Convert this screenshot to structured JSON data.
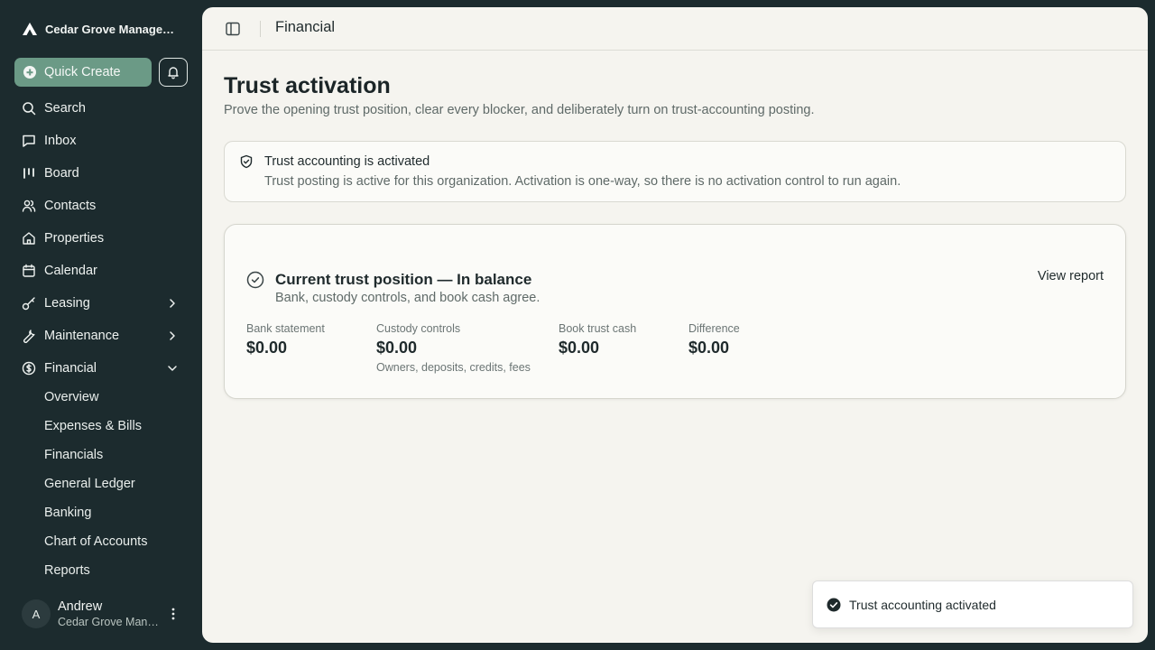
{
  "sidebar": {
    "org_name": "Cedar Grove Manageme...",
    "quick_create_label": "Quick Create",
    "nav": {
      "search": "Search",
      "inbox": "Inbox",
      "board": "Board",
      "contacts": "Contacts",
      "properties": "Properties",
      "calendar": "Calendar",
      "leasing": "Leasing",
      "maintenance": "Maintenance",
      "financial": "Financial"
    },
    "financial_items": [
      "Overview",
      "Expenses & Bills",
      "Financials",
      "General Ledger",
      "Banking",
      "Chart of Accounts",
      "Reports"
    ],
    "user": {
      "initial": "A",
      "name": "Andrew",
      "org": "Cedar Grove Mana..."
    }
  },
  "topbar": {
    "title": "Financial"
  },
  "page": {
    "title": "Trust activation",
    "subtitle": "Prove the opening trust position, clear every blocker, and deliberately turn on trust-accounting posting."
  },
  "alert": {
    "title": "Trust accounting is activated",
    "body": "Trust posting is active for this organization. Activation is one-way, so there is no activation control to run again."
  },
  "trust_card": {
    "title": "Current trust position — In balance",
    "subtitle": "Bank, custody controls, and book cash agree.",
    "view_report_label": "View report",
    "metrics": [
      {
        "label": "Bank statement",
        "value": "$0.00"
      },
      {
        "label": "Custody controls",
        "value": "$0.00",
        "note": "Owners, deposits, credits, fees"
      },
      {
        "label": "Book trust cash",
        "value": "$0.00"
      },
      {
        "label": "Difference",
        "value": "$0.00"
      }
    ]
  },
  "toast": {
    "message": "Trust accounting activated"
  },
  "colors": {
    "sidebar_bg": "#1c2b2e",
    "accent_green": "#6b9a86",
    "main_bg": "#f5f4ef"
  }
}
